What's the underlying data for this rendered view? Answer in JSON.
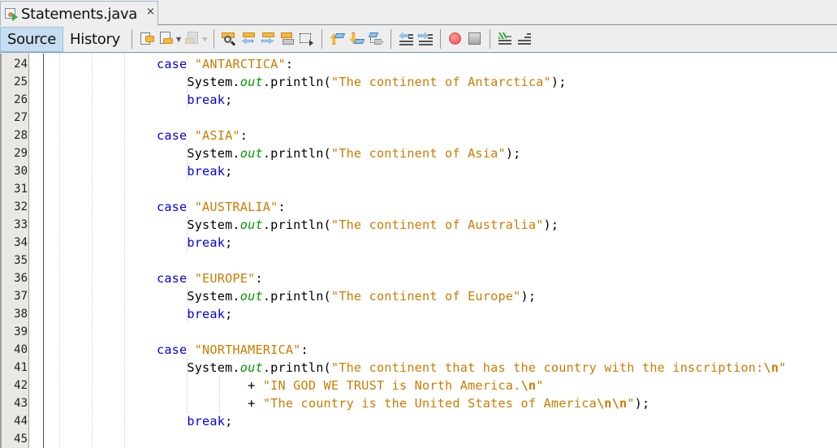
{
  "tab": {
    "title": "Statements.java",
    "icon": "java-file-icon",
    "close": "×"
  },
  "toolbar": {
    "source_label": "Source",
    "history_label": "History",
    "icons": [
      "last-edit-icon",
      "back-icon",
      "forward-icon",
      "find-selection-icon",
      "find-previous-icon",
      "find-next-icon",
      "toggle-highlight-search-icon",
      "toggle-rectangular-selection-icon",
      "previous-bookmark-icon",
      "next-bookmark-icon",
      "toggle-bookmark-icon",
      "shift-line-left-icon",
      "shift-line-right-icon",
      "start-macro-recording-icon",
      "stop-macro-recording-icon",
      "comment-icon",
      "uncomment-icon"
    ]
  },
  "editor": {
    "line_numbers": [
      "24",
      "25",
      "26",
      "27",
      "28",
      "29",
      "30",
      "31",
      "32",
      "33",
      "34",
      "35",
      "36",
      "37",
      "38",
      "39",
      "40",
      "41",
      "42",
      "43",
      "44",
      "45"
    ],
    "lines": [
      [
        {
          "t": "kw",
          "v": "case "
        },
        {
          "t": "str",
          "v": "\"ANTARCTICA\""
        },
        {
          "t": "p",
          "v": ":"
        }
      ],
      [
        {
          "t": "p",
          "v": "    System."
        },
        {
          "t": "fld",
          "v": "out"
        },
        {
          "t": "p",
          "v": ".println("
        },
        {
          "t": "str",
          "v": "\"The continent of Antarctica\""
        },
        {
          "t": "p",
          "v": ");"
        }
      ],
      [
        {
          "t": "kw",
          "v": "    break"
        },
        {
          "t": "p",
          "v": ";"
        }
      ],
      [],
      [
        {
          "t": "kw",
          "v": "case "
        },
        {
          "t": "str",
          "v": "\"ASIA\""
        },
        {
          "t": "p",
          "v": ":"
        }
      ],
      [
        {
          "t": "p",
          "v": "    System."
        },
        {
          "t": "fld",
          "v": "out"
        },
        {
          "t": "p",
          "v": ".println("
        },
        {
          "t": "str",
          "v": "\"The continent of Asia\""
        },
        {
          "t": "p",
          "v": ");"
        }
      ],
      [
        {
          "t": "kw",
          "v": "    break"
        },
        {
          "t": "p",
          "v": ";"
        }
      ],
      [],
      [
        {
          "t": "kw",
          "v": "case "
        },
        {
          "t": "str",
          "v": "\"AUSTRALIA\""
        },
        {
          "t": "p",
          "v": ":"
        }
      ],
      [
        {
          "t": "p",
          "v": "    System."
        },
        {
          "t": "fld",
          "v": "out"
        },
        {
          "t": "p",
          "v": ".println("
        },
        {
          "t": "str",
          "v": "\"The continent of Australia\""
        },
        {
          "t": "p",
          "v": ");"
        }
      ],
      [
        {
          "t": "kw",
          "v": "    break"
        },
        {
          "t": "p",
          "v": ";"
        }
      ],
      [],
      [
        {
          "t": "kw",
          "v": "case "
        },
        {
          "t": "str",
          "v": "\"EUROPE\""
        },
        {
          "t": "p",
          "v": ":"
        }
      ],
      [
        {
          "t": "p",
          "v": "    System."
        },
        {
          "t": "fld",
          "v": "out"
        },
        {
          "t": "p",
          "v": ".println("
        },
        {
          "t": "str",
          "v": "\"The continent of Europe\""
        },
        {
          "t": "p",
          "v": ");"
        }
      ],
      [
        {
          "t": "kw",
          "v": "    break"
        },
        {
          "t": "p",
          "v": ";"
        }
      ],
      [],
      [
        {
          "t": "kw",
          "v": "case "
        },
        {
          "t": "str",
          "v": "\"NORTHAMERICA\""
        },
        {
          "t": "p",
          "v": ":"
        }
      ],
      [
        {
          "t": "p",
          "v": "    System."
        },
        {
          "t": "fld",
          "v": "out"
        },
        {
          "t": "p",
          "v": ".println("
        },
        {
          "t": "str",
          "v": "\"The continent that has the country with the inscription:"
        },
        {
          "t": "esc",
          "v": "\\n"
        },
        {
          "t": "str",
          "v": "\""
        }
      ],
      [
        {
          "t": "p",
          "v": "            + "
        },
        {
          "t": "str",
          "v": "\"IN GOD WE TRUST is North America."
        },
        {
          "t": "esc",
          "v": "\\n"
        },
        {
          "t": "str",
          "v": "\""
        }
      ],
      [
        {
          "t": "p",
          "v": "            + "
        },
        {
          "t": "str",
          "v": "\"The country is the United States of America"
        },
        {
          "t": "esc",
          "v": "\\n\\n"
        },
        {
          "t": "str",
          "v": "\""
        },
        {
          "t": "p",
          "v": ");"
        }
      ],
      [
        {
          "t": "kw",
          "v": "    break"
        },
        {
          "t": "p",
          "v": ";"
        }
      ],
      []
    ]
  }
}
